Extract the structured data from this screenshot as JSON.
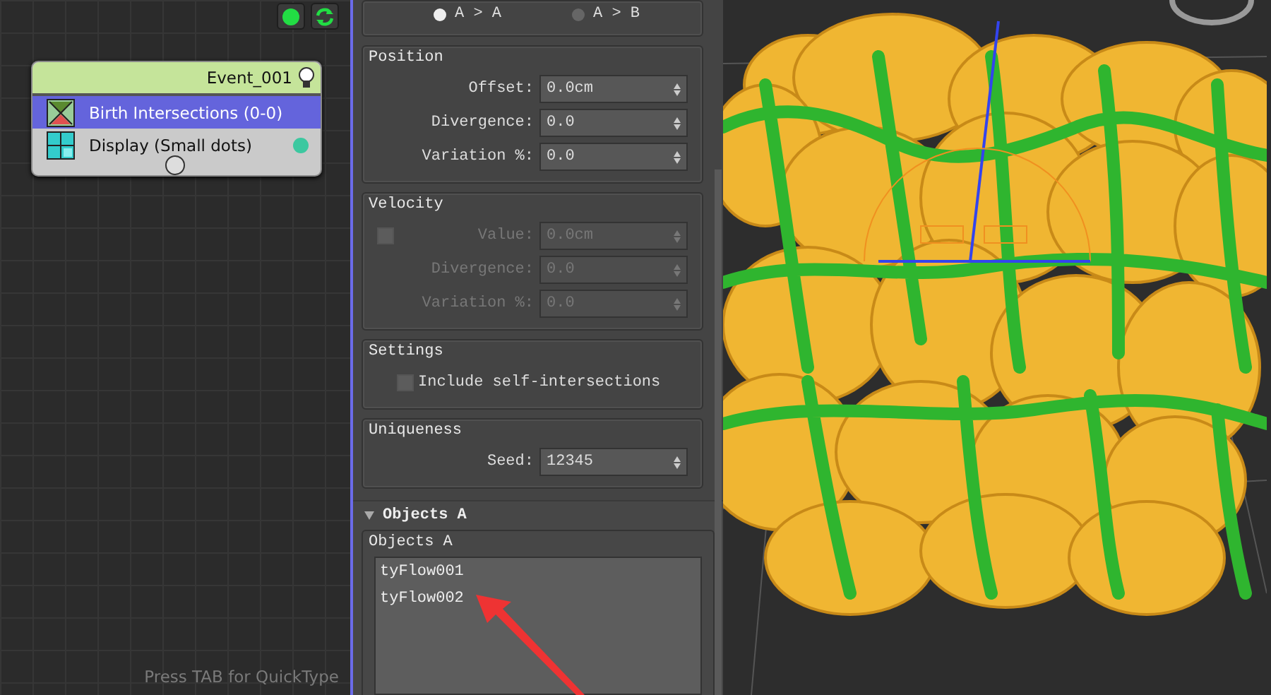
{
  "node_editor": {
    "node": {
      "title": "Event_001",
      "operators": [
        {
          "label": "Birth Intersections (0-0)",
          "selected": true,
          "kind": "birth"
        },
        {
          "label": "Display (Small dots)",
          "selected": false,
          "kind": "display",
          "color": "#3cc8a0"
        }
      ]
    },
    "hint": "Press TAB for QuickType"
  },
  "properties": {
    "radio_options": [
      {
        "label": "A > A",
        "selected": true
      },
      {
        "label": "A > B",
        "selected": false
      }
    ],
    "groups": [
      {
        "title": "Position",
        "rows": [
          {
            "kind": "spinner",
            "label": "Offset:",
            "value": "0.0cm",
            "disabled": false
          },
          {
            "kind": "spinner",
            "label": "Divergence:",
            "value": "0.0",
            "disabled": false
          },
          {
            "kind": "spinner",
            "label": "Variation %:",
            "value": "0.0",
            "disabled": false
          }
        ]
      },
      {
        "title": "Velocity",
        "rows": [
          {
            "kind": "spinner",
            "label": "Value:",
            "value": "0.0cm",
            "disabled": true,
            "checkbox": {
              "checked": false
            }
          },
          {
            "kind": "spinner",
            "label": "Divergence:",
            "value": "0.0",
            "disabled": true
          },
          {
            "kind": "spinner",
            "label": "Variation %:",
            "value": "0.0",
            "disabled": true
          }
        ]
      },
      {
        "title": "Settings",
        "rows": [
          {
            "kind": "checkbox",
            "label": "Include self-intersections",
            "checked": false
          }
        ]
      },
      {
        "title": "Uniqueness",
        "rows": [
          {
            "kind": "spinner",
            "label": "Seed:",
            "value": "12345",
            "disabled": false
          }
        ]
      }
    ],
    "rollout": {
      "title": "Objects A",
      "expanded": true,
      "group_title": "Objects A",
      "items": [
        {
          "label": "tyFlow001"
        },
        {
          "label": "tyFlow002"
        }
      ]
    }
  }
}
